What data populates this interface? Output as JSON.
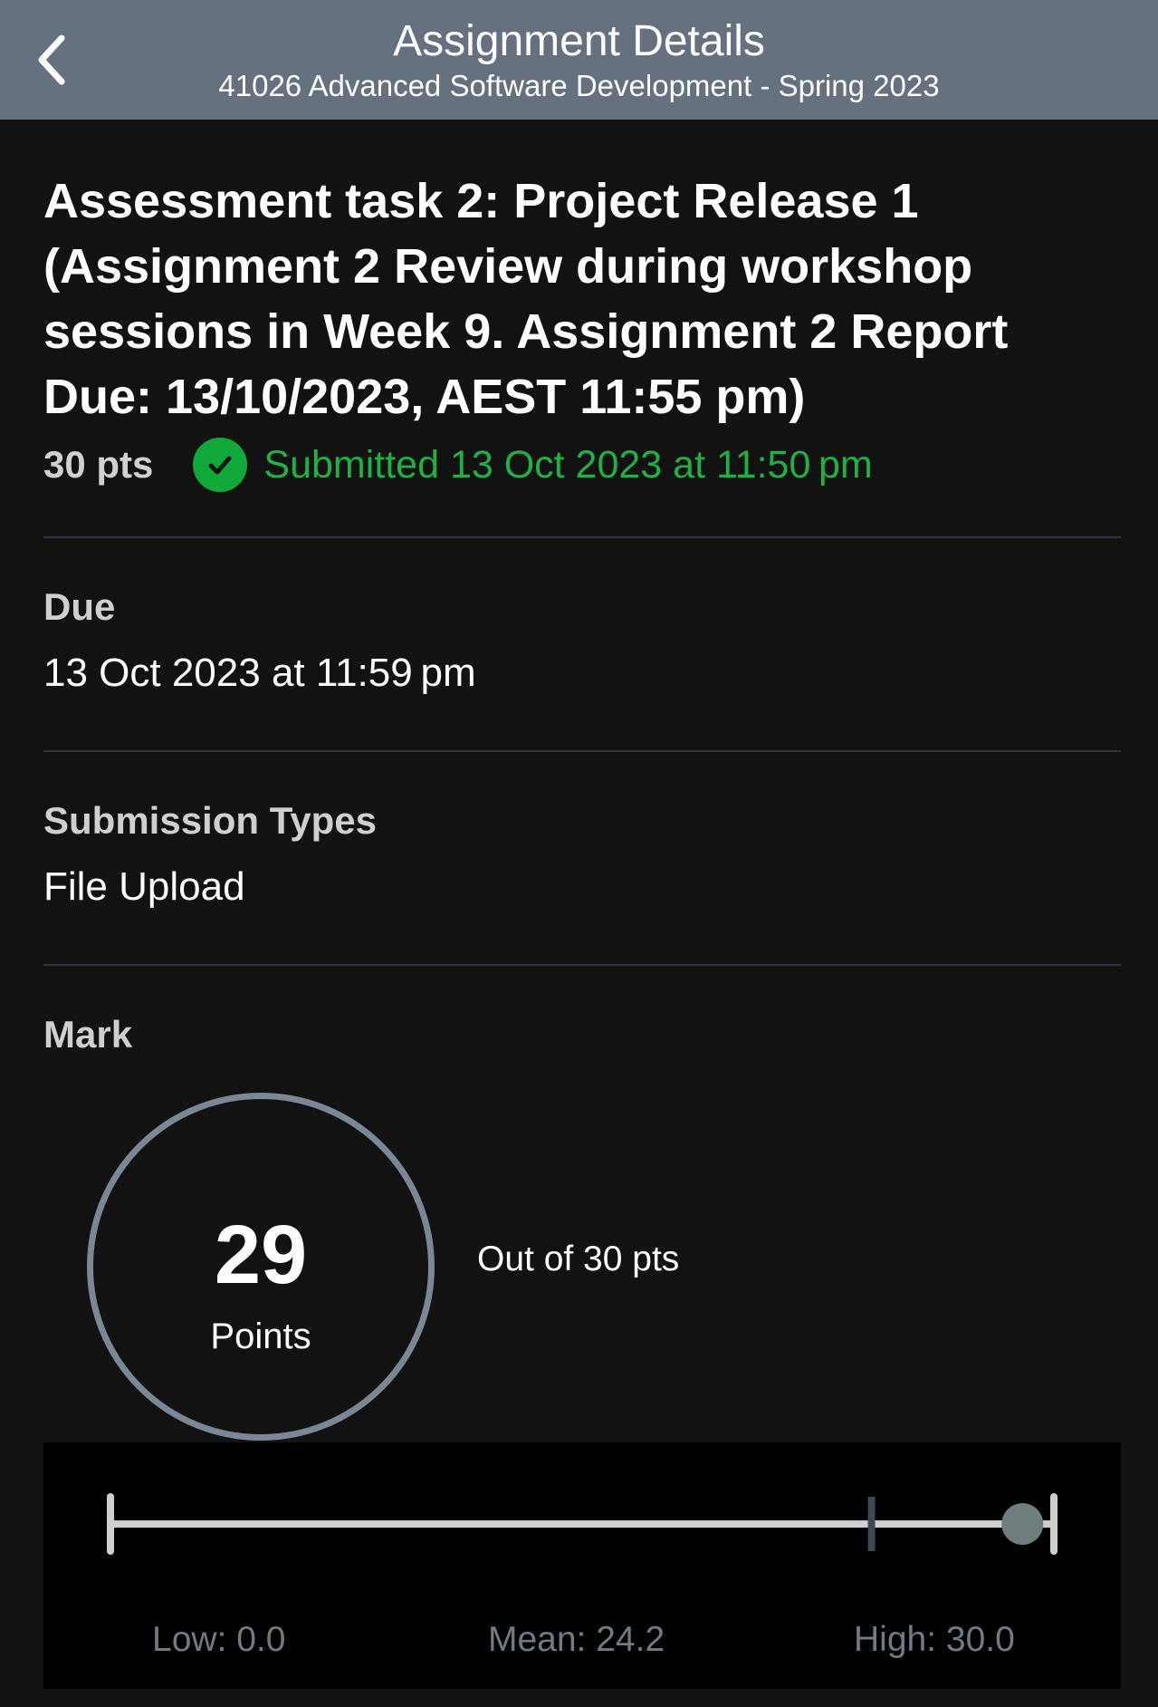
{
  "nav": {
    "title": "Assignment Details",
    "subtitle": "41026 Advanced Software Development - Spring 2023"
  },
  "assignment": {
    "title": "Assessment task 2: Project Release 1 (Assignment 2 Review during workshop sessions in Week 9. Assignment 2 Report Due: 13/10/2023, AEST 11:55 pm)",
    "points": "30 pts",
    "submission_status": "Submitted 13 Oct 2023 at 11:50 pm"
  },
  "due": {
    "label": "Due",
    "value": "13 Oct 2023 at 11:59 pm"
  },
  "submission_types": {
    "label": "Submission Types",
    "value": "File Upload"
  },
  "mark": {
    "label": "Mark",
    "score": "29",
    "unit": "Points",
    "out_of": "Out of 30 pts"
  },
  "stats": {
    "low_label": "Low: 0.0",
    "mean_label": "Mean: 24.2",
    "high_label": "High: 30.0",
    "low": 0.0,
    "mean": 24.2,
    "high": 30.0,
    "score": 29
  },
  "colors": {
    "nav_bg": "#66717f",
    "submitted_green": "#1fb046",
    "ring": "#7a8797"
  },
  "icons": {
    "back": "chevron-left-icon",
    "submitted": "check-circle-icon"
  }
}
